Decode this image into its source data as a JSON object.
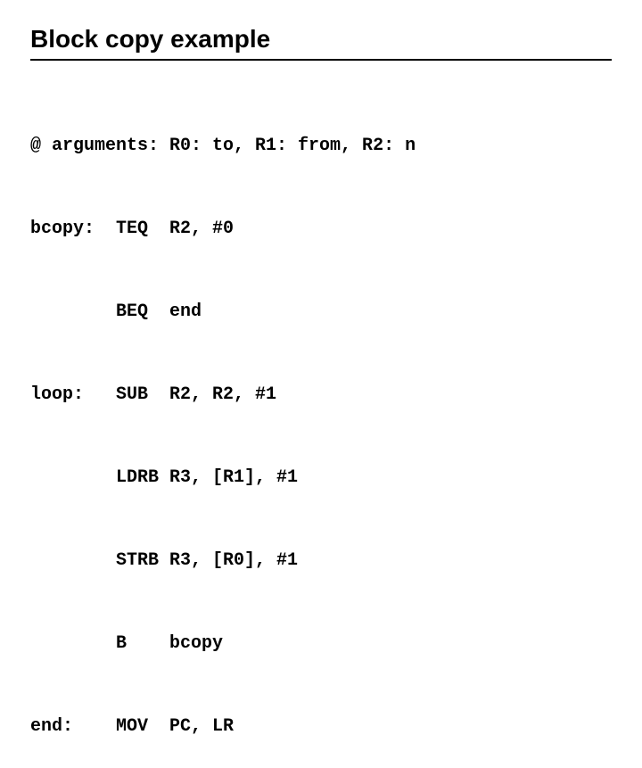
{
  "title": "Block copy example",
  "code": {
    "comment": "@ arguments: R0: to, R1: from, R2: n",
    "lines": [
      {
        "label": "bcopy:",
        "opcode": "TEQ",
        "operands": "R2, #0"
      },
      {
        "label": "",
        "opcode": "BEQ",
        "operands": "end"
      },
      {
        "label": "loop:",
        "opcode": "SUB",
        "operands": "R2, R2, #1"
      },
      {
        "label": "",
        "opcode": "LDRB",
        "operands": "R3, [R1], #1"
      },
      {
        "label": "",
        "opcode": "STRB",
        "operands": "R3, [R0], #1"
      },
      {
        "label": "",
        "opcode": "B",
        "operands": "bcopy"
      },
      {
        "label": "end:",
        "opcode": "MOV",
        "operands": "PC, LR"
      }
    ]
  }
}
